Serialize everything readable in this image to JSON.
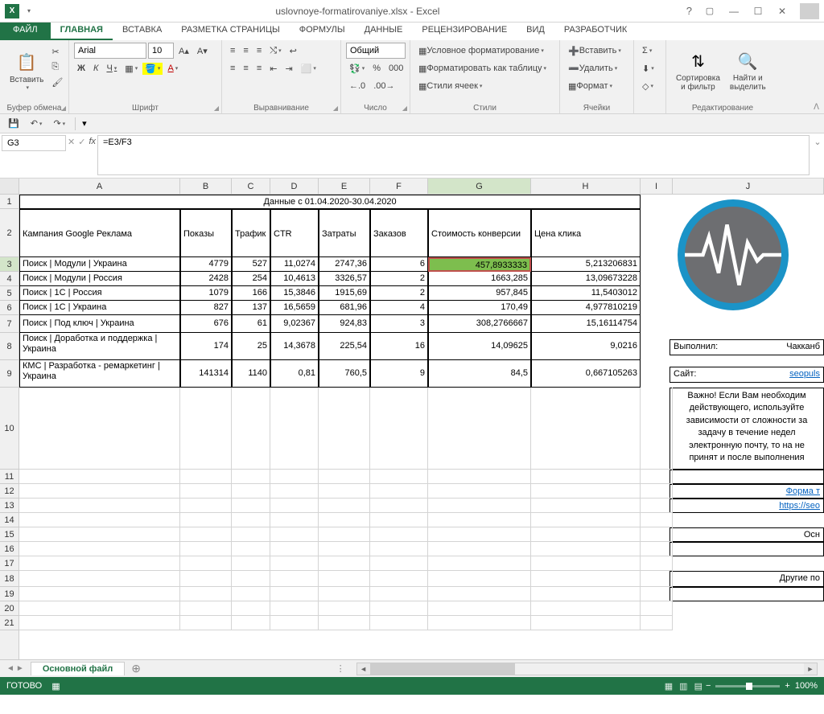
{
  "title": "uslovnoye-formatirovaniye.xlsx - Excel",
  "tabs": {
    "file": "ФАЙЛ",
    "home": "ГЛАВНАЯ",
    "insert": "ВСТАВКА",
    "pagelayout": "РАЗМЕТКА СТРАНИЦЫ",
    "formulas": "ФОРМУЛЫ",
    "data": "ДАННЫЕ",
    "review": "РЕЦЕНЗИРОВАНИЕ",
    "view": "ВИД",
    "developer": "РАЗРАБОТЧИК"
  },
  "ribbon": {
    "paste": "Вставить",
    "clipboard": "Буфер обмена",
    "font_group": "Шрифт",
    "font_name": "Arial",
    "font_size": "10",
    "alignment": "Выравнивание",
    "number_group": "Число",
    "number_format": "Общий",
    "styles_group": "Стили",
    "cond_fmt": "Условное форматирование",
    "fmt_table": "Форматировать как таблицу",
    "cell_styles": "Стили ячеек",
    "cells_group": "Ячейки",
    "insert": "Вставить",
    "delete": "Удалить",
    "format": "Формат",
    "editing_group": "Редактирование",
    "sort_filter": "Сортировка\nи фильтр",
    "find_select": "Найти и\nвыделить"
  },
  "name_box": "G3",
  "formula": "=E3/F3",
  "columns": [
    "A",
    "B",
    "C",
    "D",
    "E",
    "F",
    "G",
    "H",
    "I",
    "J"
  ],
  "headers": {
    "title_row": "Данные с 01.04.2020-30.04.2020",
    "A": "Кампания Google Реклама",
    "B": "Показы",
    "C": "Трафик",
    "D": "CTR",
    "E": "Затраты",
    "F": "Заказов через корзину",
    "G": "Стоимость конверсии",
    "H": "Цена клика"
  },
  "rows": [
    {
      "A": "Поиск | Модули | Украина",
      "B": "4779",
      "C": "527",
      "D": "11,0274",
      "E": "2747,36",
      "F": "6",
      "G": "457,8933333",
      "H": "5,213206831"
    },
    {
      "A": "Поиск | Модули | Россия",
      "B": "2428",
      "C": "254",
      "D": "10,4613",
      "E": "3326,57",
      "F": "2",
      "G": "1663,285",
      "H": "13,09673228"
    },
    {
      "A": "Поиск | 1С | Россия",
      "B": "1079",
      "C": "166",
      "D": "15,3846",
      "E": "1915,69",
      "F": "2",
      "G": "957,845",
      "H": "11,5403012"
    },
    {
      "A": "Поиск | 1С | Украина",
      "B": "827",
      "C": "137",
      "D": "16,5659",
      "E": "681,96",
      "F": "4",
      "G": "170,49",
      "H": "4,977810219"
    },
    {
      "A": "Поиск | Под ключ | Украина",
      "B": "676",
      "C": "61",
      "D": "9,02367",
      "E": "924,83",
      "F": "3",
      "G": "308,2766667",
      "H": "15,16114754"
    },
    {
      "A": "Поиск | Доработка и поддержка | Украина",
      "B": "174",
      "C": "25",
      "D": "14,3678",
      "E": "225,54",
      "F": "16",
      "G": "14,09625",
      "H": "9,0216"
    },
    {
      "A": "КМС | Разработка - ремаркетинг | Украина",
      "B": "141314",
      "C": "1140",
      "D": "0,81",
      "E": "760,5",
      "F": "9",
      "G": "84,5",
      "H": "0,667105263"
    }
  ],
  "side": {
    "vypolnil_label": "Выполнил:",
    "vypolnil_val": "Чакканб",
    "site_label": "Сайт:",
    "site_val": "seopuls",
    "note": "Важно! Если Вам необходим\nдействующего, используйте\nзависимости от сложности за\nзадачу в течение недел\nэлектронную почту, то на не\nпринят и после выполнения",
    "form": "Форма т",
    "url": "https://seo",
    "osn": "Осн",
    "other": "Другие по"
  },
  "sheet_tab": "Основной файл",
  "status": "ГОТОВО",
  "zoom": "100%"
}
